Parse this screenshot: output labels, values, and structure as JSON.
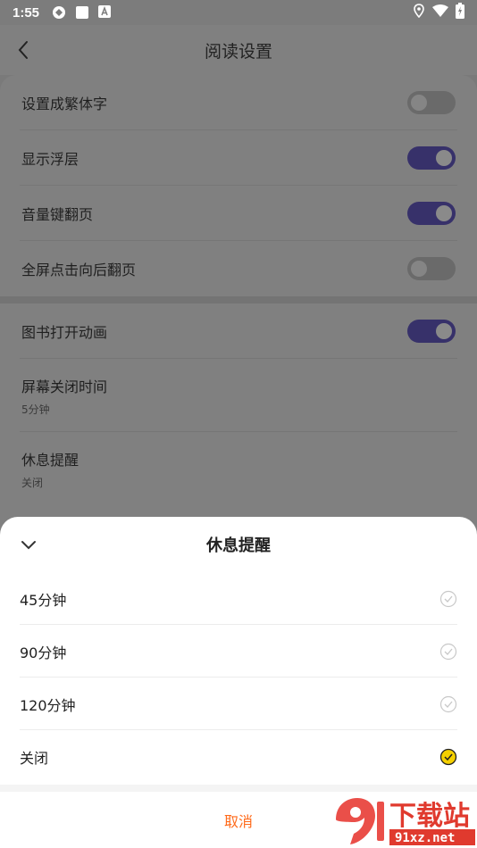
{
  "status_bar": {
    "time": "1:55",
    "left_icons": [
      "sync-icon",
      "square-icon",
      "a-badge-icon"
    ],
    "right_icons": [
      "location-icon",
      "wifi-icon",
      "battery-charging-icon"
    ]
  },
  "header": {
    "title": "阅读设置",
    "back_icon": "chevron-left-icon"
  },
  "settings_group1": [
    {
      "label": "设置成繁体字",
      "toggle": false
    },
    {
      "label": "显示浮层",
      "toggle": true
    },
    {
      "label": "音量键翻页",
      "toggle": true
    },
    {
      "label": "全屏点击向后翻页",
      "toggle": false
    }
  ],
  "settings_group2": {
    "animation": {
      "label": "图书打开动画",
      "toggle": true
    },
    "screen_off": {
      "label": "屏幕关闭时间",
      "value": "5分钟"
    },
    "rest_reminder": {
      "label": "休息提醒",
      "value": "关闭"
    }
  },
  "sheet": {
    "title": "休息提醒",
    "collapse_icon": "chevron-down-icon",
    "options": [
      {
        "label": "45分钟",
        "selected": false
      },
      {
        "label": "90分钟",
        "selected": false
      },
      {
        "label": "120分钟",
        "selected": false
      },
      {
        "label": "关闭",
        "selected": true
      }
    ],
    "cancel_label": "取消"
  },
  "watermark": {
    "text_top": "下载站",
    "text_bottom": "91xz.net"
  },
  "colors": {
    "toggle_on": "#37316a",
    "accent_orange": "#ff6a1a",
    "check_selected": "#f5d000"
  }
}
